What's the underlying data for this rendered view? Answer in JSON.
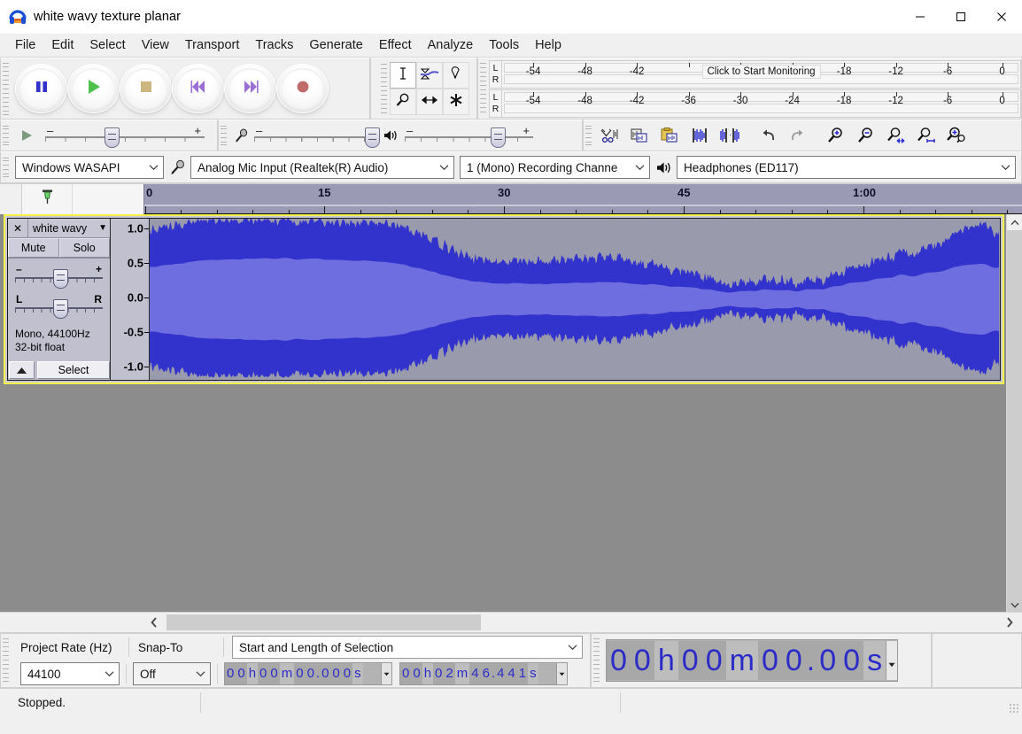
{
  "window": {
    "title": "white wavy texture planar",
    "icon": "audacity-headphones-icon",
    "minimize": "─",
    "maximize": "□",
    "close": "✕"
  },
  "menubar": {
    "items": [
      {
        "label": "File"
      },
      {
        "label": "Edit"
      },
      {
        "label": "Select"
      },
      {
        "label": "View"
      },
      {
        "label": "Transport"
      },
      {
        "label": "Tracks"
      },
      {
        "label": "Generate"
      },
      {
        "label": "Effect"
      },
      {
        "label": "Analyze"
      },
      {
        "label": "Tools"
      },
      {
        "label": "Help"
      }
    ]
  },
  "transport": {
    "buttons": [
      {
        "name": "pause-button",
        "icon": "pause-icon",
        "color": "#3333cc"
      },
      {
        "name": "play-button",
        "icon": "play-icon",
        "color": "#4cc24c"
      },
      {
        "name": "stop-button",
        "icon": "stop-icon",
        "color": "#cbb77f"
      },
      {
        "name": "skip-to-start-button",
        "icon": "skip-start-icon",
        "color": "#9b6fd4"
      },
      {
        "name": "skip-to-end-button",
        "icon": "skip-end-icon",
        "color": "#9b6fd4"
      },
      {
        "name": "record-button",
        "icon": "record-icon",
        "color": "#c06a6a"
      }
    ]
  },
  "tools": {
    "buttons": [
      {
        "name": "selection-tool",
        "icon": "i-beam-icon",
        "selected": true
      },
      {
        "name": "envelope-tool",
        "icon": "envelope-icon",
        "selected": false
      },
      {
        "name": "draw-tool",
        "icon": "pencil-icon",
        "selected": false
      },
      {
        "name": "zoom-tool",
        "icon": "magnifier-icon",
        "selected": false
      },
      {
        "name": "timeshift-tool",
        "icon": "double-arrow-icon",
        "selected": false
      },
      {
        "name": "multi-tool",
        "icon": "asterisk-icon",
        "selected": false
      }
    ]
  },
  "meters": {
    "recording": {
      "icon": "microphone-icon",
      "channels": [
        "L",
        "R"
      ],
      "tooltip": "Click to Start Monitoring",
      "ticks": [
        -54,
        -48,
        -42,
        -36,
        -30,
        -24,
        -18,
        -12,
        -6,
        0
      ],
      "labels": [
        "-54",
        "-48",
        "-42",
        "-18",
        "-12",
        "-6",
        "0"
      ]
    },
    "playback": {
      "icon": "speaker-icon",
      "channels": [
        "L",
        "R"
      ],
      "ticks": [
        -54,
        -48,
        -42,
        -36,
        -30,
        -24,
        -18,
        -12,
        -6,
        0
      ],
      "labels": [
        "-54",
        "-48",
        "-42",
        "-36",
        "-30",
        "-24",
        "-18",
        "-12",
        "-6",
        "0"
      ]
    }
  },
  "mixer": {
    "play_icon": "play-small-icon",
    "playback_volume": {
      "minus": "–",
      "plus": "+",
      "value": 37
    },
    "recording_icon": "microphone-icon",
    "recording_volume": {
      "minus": "–",
      "plus": "+",
      "value": 86
    },
    "speaker_icon": "speaker-icon",
    "output_volume": {
      "minus": "–",
      "plus": "+",
      "value": 70
    }
  },
  "edit_toolbar": {
    "buttons": [
      {
        "name": "cut-button",
        "icon": "scissors-icon"
      },
      {
        "name": "copy-button",
        "icon": "copy-icon"
      },
      {
        "name": "paste-button",
        "icon": "clipboard-icon"
      },
      {
        "name": "trim-audio-button",
        "icon": "trim-icon"
      },
      {
        "name": "silence-audio-button",
        "icon": "silence-icon"
      },
      {
        "name": "undo-button",
        "icon": "undo-arrow-icon"
      },
      {
        "name": "redo-button",
        "icon": "redo-arrow-icon"
      },
      {
        "name": "zoom-in-button",
        "icon": "zoom-in-icon"
      },
      {
        "name": "zoom-out-button",
        "icon": "zoom-out-icon"
      },
      {
        "name": "fit-selection-button",
        "icon": "fit-selection-icon"
      },
      {
        "name": "fit-project-button",
        "icon": "fit-project-icon"
      },
      {
        "name": "zoom-toggle-button",
        "icon": "zoom-toggle-icon"
      }
    ]
  },
  "device_toolbar": {
    "host": {
      "label": "Windows WASAPI",
      "arrow": "⌄"
    },
    "input_icon": "microphone-icon",
    "input_device": {
      "label": "Analog Mic Input (Realtek(R) Audio)",
      "arrow": "⌄"
    },
    "channels": {
      "label": "1 (Mono) Recording Channe",
      "arrow": "⌄"
    },
    "output_icon": "speaker-icon",
    "output_device": {
      "label": "Headphones (ED117)",
      "arrow": "⌄"
    }
  },
  "timeline": {
    "pin_icon": "pin-green-icon",
    "labels": [
      {
        "text": "0",
        "pos": 0
      },
      {
        "text": "15",
        "pos": 203
      },
      {
        "text": "30",
        "pos": 406
      },
      {
        "text": "45",
        "pos": 609
      },
      {
        "text": "1:00",
        "pos": 812
      }
    ],
    "major_ticks": [
      0,
      203,
      406,
      609,
      812,
      1015
    ],
    "minor_step": 40.6
  },
  "track": {
    "close_label": "✕",
    "name": "white wavy",
    "menu_arrow": "▼",
    "mute_label": "Mute",
    "solo_label": "Solo",
    "gain": {
      "minus": "–",
      "plus": "+"
    },
    "pan": {
      "left": "L",
      "right": "R"
    },
    "info_line1": "Mono, 44100Hz",
    "info_line2": "32-bit float",
    "collapse_icon": "▲",
    "select_label": "Select",
    "vertical_ruler": [
      "1.0",
      "0.5",
      "0.0",
      "-0.5",
      "-1.0"
    ],
    "colors": {
      "peak": "#3232cc",
      "rms": "#6e6ee0",
      "background": "#9a9aad",
      "selected_border": "#f2f24a"
    }
  },
  "scrollbars": {
    "left_arrow": "‹",
    "right_arrow": "›",
    "up_arrow": "∧",
    "down_arrow": "∨"
  },
  "selection_toolbar": {
    "project_rate_label": "Project Rate (Hz)",
    "snap_to_label": "Snap-To",
    "selection_mode": {
      "label": "Start and Length of Selection",
      "arrow": "⌄"
    },
    "project_rate_value": "44100",
    "snap_to_value": "Off",
    "start_time": {
      "digits": [
        "0",
        "0",
        "h",
        "0",
        "0",
        "m",
        "0",
        "0",
        ".",
        "0",
        "0",
        "0",
        "s"
      ],
      "text": "00 h 00 m 00.000 s"
    },
    "length_time": {
      "digits": [
        "0",
        "0",
        "h",
        "0",
        "2",
        "m",
        "4",
        "6",
        ".",
        "4",
        "4",
        "1",
        "s"
      ],
      "text": "00 h 02 m 46.441 s"
    }
  },
  "time_display": {
    "digits": [
      "0",
      "0",
      "h",
      "0",
      "0",
      "m",
      "0",
      "0",
      ".",
      "0",
      "0",
      "s"
    ],
    "text": "00 h 00 m 00.00 s"
  },
  "statusbar": {
    "message": "Stopped.",
    "cell2": "",
    "cell3": ""
  }
}
